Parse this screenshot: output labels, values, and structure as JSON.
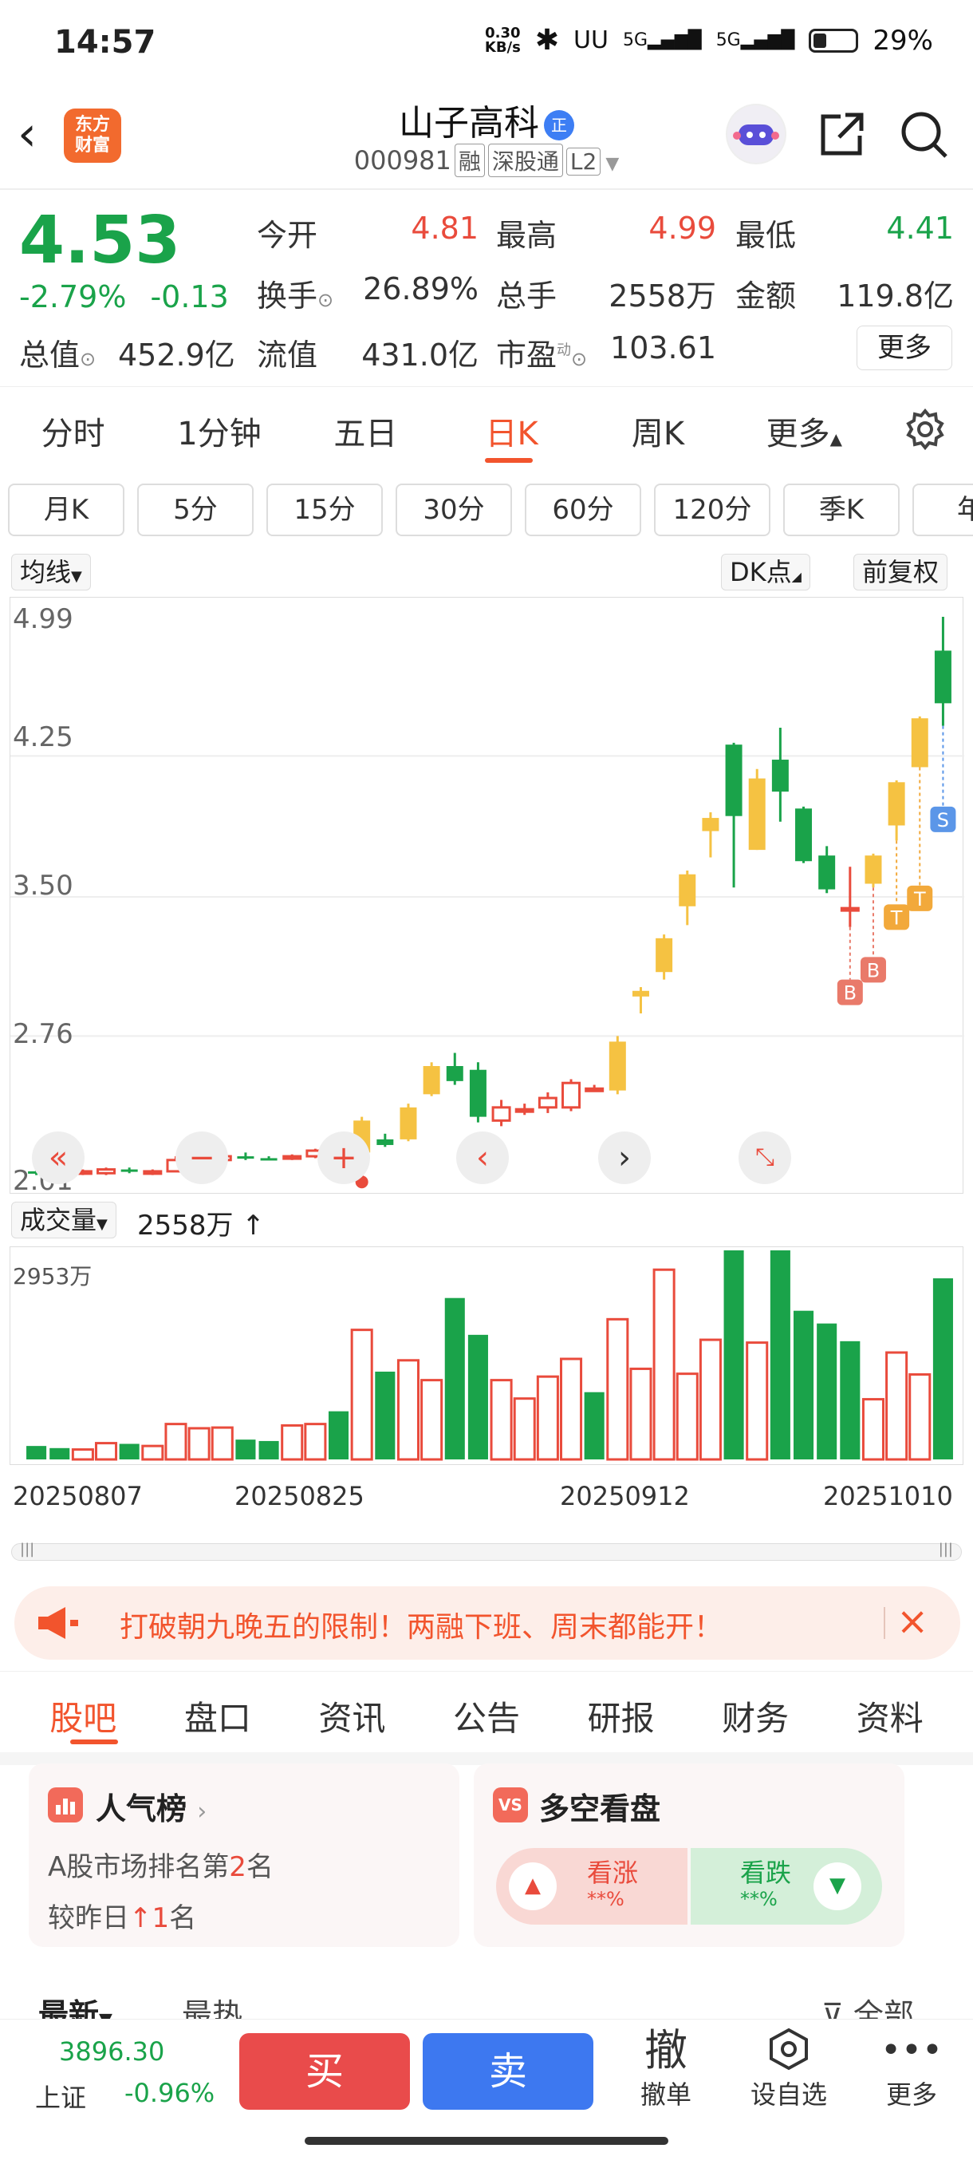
{
  "status_bar": {
    "time": "14:57",
    "speed_top": "0.30",
    "speed_bottom": "KB/s",
    "net1": "5G",
    "net2": "5G",
    "battery": "29%"
  },
  "header": {
    "logo_line1": "东方",
    "logo_line2": "财富",
    "stock_name": "山子高科",
    "badge": "正",
    "code": "000981",
    "tags": [
      "融",
      "深股通",
      "L2"
    ]
  },
  "quote": {
    "price": "4.53",
    "change_pct": "-2.79%",
    "change": "-0.13",
    "open_label": "今开",
    "open": "4.81",
    "high_label": "最高",
    "high": "4.99",
    "low_label": "最低",
    "low": "4.41",
    "turnover_label": "换手",
    "turnover": "26.89%",
    "volume_label": "总手",
    "volume": "2558万",
    "amount_label": "金额",
    "amount": "119.8亿",
    "mktcap_label": "总值",
    "mktcap": "452.9亿",
    "float_label": "流值",
    "float": "431.0亿",
    "pe_label": "市盈",
    "pe_sup": "动",
    "pe": "103.61",
    "more": "更多"
  },
  "chart_tabs": [
    "分时",
    "1分钟",
    "五日",
    "日K",
    "周K",
    "更多"
  ],
  "period_chips": [
    "月K",
    "5分",
    "15分",
    "30分",
    "60分",
    "120分",
    "季K",
    "年"
  ],
  "chart_controls": {
    "ma": "均线",
    "dk": "DK点",
    "adjust": "前复权"
  },
  "y_axis": [
    "4.99",
    "4.25",
    "3.50",
    "2.76",
    "2.01"
  ],
  "volume_header": {
    "label": "成交量",
    "value": "2558万",
    "max": "2953万"
  },
  "date_labels": [
    "20250807",
    "20250825",
    "20250912",
    "20251010"
  ],
  "signal_labels": {
    "buy": "B",
    "sell": "S",
    "t": "T"
  },
  "colors": {
    "up": "#e94b3c",
    "down": "#1aa34a",
    "yellow": "#f5c242",
    "accent": "#f2542d"
  },
  "chart_data": {
    "type": "candlestick",
    "ylim": [
      2.01,
      4.99
    ],
    "candles": [
      {
        "o": 2.04,
        "h": 2.06,
        "l": 2.02,
        "c": 2.03,
        "k": "down"
      },
      {
        "o": 2.03,
        "h": 2.05,
        "l": 2.02,
        "c": 2.04,
        "k": "down"
      },
      {
        "o": 2.03,
        "h": 2.05,
        "l": 2.02,
        "c": 2.04,
        "k": "up"
      },
      {
        "o": 2.03,
        "h": 2.06,
        "l": 2.02,
        "c": 2.05,
        "k": "up"
      },
      {
        "o": 2.05,
        "h": 2.06,
        "l": 2.03,
        "c": 2.04,
        "k": "down"
      },
      {
        "o": 2.03,
        "h": 2.05,
        "l": 2.02,
        "c": 2.04,
        "k": "up"
      },
      {
        "o": 2.04,
        "h": 2.12,
        "l": 2.04,
        "c": 2.1,
        "k": "up"
      },
      {
        "o": 2.09,
        "h": 2.12,
        "l": 2.07,
        "c": 2.1,
        "k": "up"
      },
      {
        "o": 2.1,
        "h": 2.13,
        "l": 2.09,
        "c": 2.12,
        "k": "up"
      },
      {
        "o": 2.12,
        "h": 2.14,
        "l": 2.1,
        "c": 2.11,
        "k": "down"
      },
      {
        "o": 2.11,
        "h": 2.12,
        "l": 2.1,
        "c": 2.11,
        "k": "down"
      },
      {
        "o": 2.11,
        "h": 2.13,
        "l": 2.1,
        "c": 2.12,
        "k": "up"
      },
      {
        "o": 2.12,
        "h": 2.16,
        "l": 2.11,
        "c": 2.15,
        "k": "up"
      },
      {
        "o": 2.14,
        "h": 2.16,
        "l": 2.12,
        "c": 2.13,
        "k": "down"
      },
      {
        "o": 2.14,
        "h": 2.33,
        "l": 2.13,
        "c": 2.31,
        "k": "yellow"
      },
      {
        "o": 2.21,
        "h": 2.24,
        "l": 2.17,
        "c": 2.18,
        "k": "down"
      },
      {
        "o": 2.21,
        "h": 2.4,
        "l": 2.2,
        "c": 2.38,
        "k": "yellow"
      },
      {
        "o": 2.45,
        "h": 2.62,
        "l": 2.44,
        "c": 2.6,
        "k": "yellow"
      },
      {
        "o": 2.6,
        "h": 2.67,
        "l": 2.5,
        "c": 2.52,
        "k": "down"
      },
      {
        "o": 2.58,
        "h": 2.62,
        "l": 2.3,
        "c": 2.33,
        "k": "down"
      },
      {
        "o": 2.31,
        "h": 2.42,
        "l": 2.28,
        "c": 2.38,
        "k": "up"
      },
      {
        "o": 2.37,
        "h": 2.4,
        "l": 2.34,
        "c": 2.37,
        "k": "up"
      },
      {
        "o": 2.38,
        "h": 2.46,
        "l": 2.35,
        "c": 2.43,
        "k": "up"
      },
      {
        "o": 2.38,
        "h": 2.53,
        "l": 2.36,
        "c": 2.51,
        "k": "up"
      },
      {
        "o": 2.48,
        "h": 2.5,
        "l": 2.47,
        "c": 2.48,
        "k": "up"
      },
      {
        "o": 2.47,
        "h": 2.76,
        "l": 2.45,
        "c": 2.73,
        "k": "yellow"
      },
      {
        "o": 2.97,
        "h": 3.02,
        "l": 2.88,
        "c": 3.0,
        "k": "yellow"
      },
      {
        "o": 3.1,
        "h": 3.3,
        "l": 3.06,
        "c": 3.28,
        "k": "yellow"
      },
      {
        "o": 3.45,
        "h": 3.64,
        "l": 3.35,
        "c": 3.62,
        "k": "yellow"
      },
      {
        "o": 3.85,
        "h": 3.95,
        "l": 3.71,
        "c": 3.92,
        "k": "yellow"
      },
      {
        "o": 4.31,
        "h": 4.32,
        "l": 3.55,
        "c": 3.93,
        "k": "down"
      },
      {
        "o": 3.75,
        "h": 4.18,
        "l": 3.75,
        "c": 4.13,
        "k": "yellow"
      },
      {
        "o": 4.23,
        "h": 4.4,
        "l": 3.9,
        "c": 4.06,
        "k": "down"
      },
      {
        "o": 3.97,
        "h": 3.98,
        "l": 3.68,
        "c": 3.69,
        "k": "down"
      },
      {
        "o": 3.72,
        "h": 3.77,
        "l": 3.52,
        "c": 3.54,
        "k": "down"
      },
      {
        "o": 3.43,
        "h": 3.66,
        "l": 3.34,
        "c": 3.44,
        "k": "up"
      },
      {
        "o": 3.57,
        "h": 3.73,
        "l": 3.55,
        "c": 3.72,
        "k": "yellow"
      },
      {
        "o": 3.88,
        "h": 4.12,
        "l": 3.8,
        "c": 4.11,
        "k": "yellow"
      },
      {
        "o": 4.19,
        "h": 4.46,
        "l": 4.19,
        "c": 4.45,
        "k": "yellow"
      },
      {
        "o": 4.81,
        "h": 4.99,
        "l": 4.41,
        "c": 4.53,
        "k": "down"
      }
    ],
    "volume": [
      {
        "v": 190,
        "k": "down"
      },
      {
        "v": 160,
        "k": "down"
      },
      {
        "v": 140,
        "k": "up"
      },
      {
        "v": 230,
        "k": "up"
      },
      {
        "v": 220,
        "k": "down"
      },
      {
        "v": 190,
        "k": "up"
      },
      {
        "v": 500,
        "k": "up"
      },
      {
        "v": 440,
        "k": "up"
      },
      {
        "v": 450,
        "k": "up"
      },
      {
        "v": 280,
        "k": "down"
      },
      {
        "v": 260,
        "k": "down"
      },
      {
        "v": 480,
        "k": "up"
      },
      {
        "v": 500,
        "k": "up"
      },
      {
        "v": 680,
        "k": "down"
      },
      {
        "v": 1830,
        "k": "up"
      },
      {
        "v": 1240,
        "k": "down"
      },
      {
        "v": 1400,
        "k": "up"
      },
      {
        "v": 1120,
        "k": "up"
      },
      {
        "v": 2280,
        "k": "down"
      },
      {
        "v": 1760,
        "k": "down"
      },
      {
        "v": 1120,
        "k": "up"
      },
      {
        "v": 860,
        "k": "up"
      },
      {
        "v": 1170,
        "k": "up"
      },
      {
        "v": 1420,
        "k": "up"
      },
      {
        "v": 950,
        "k": "down"
      },
      {
        "v": 1980,
        "k": "up"
      },
      {
        "v": 1280,
        "k": "up"
      },
      {
        "v": 2680,
        "k": "up"
      },
      {
        "v": 1210,
        "k": "up"
      },
      {
        "v": 1690,
        "k": "up"
      },
      {
        "v": 2953,
        "k": "down"
      },
      {
        "v": 1650,
        "k": "up"
      },
      {
        "v": 2953,
        "k": "down"
      },
      {
        "v": 2100,
        "k": "down"
      },
      {
        "v": 1920,
        "k": "down"
      },
      {
        "v": 1670,
        "k": "down"
      },
      {
        "v": 850,
        "k": "up"
      },
      {
        "v": 1510,
        "k": "up"
      },
      {
        "v": 1200,
        "k": "up"
      },
      {
        "v": 2558,
        "k": "down"
      }
    ]
  },
  "scroll": {
    "left": "|||",
    "right": "|||"
  },
  "banner": {
    "text": "打破朝九晚五的限制！两融下班、周末都能开！"
  },
  "bottom_tabs": [
    "股吧",
    "盘口",
    "资讯",
    "公告",
    "研报",
    "财务",
    "资料"
  ],
  "popularity": {
    "title": "人气榜",
    "line1_pre": "A股市场排名第",
    "rank": "2",
    "line1_post": "名",
    "line2_pre": "较昨日",
    "change": "1",
    "line2_post": "名"
  },
  "sentiment": {
    "title": "多空看盘",
    "bull": "看涨",
    "bull_pct": "**%",
    "bear": "看跌",
    "bear_pct": "**%"
  },
  "feed_tabs": {
    "latest": "最新",
    "hot": "最热",
    "all": "全部"
  },
  "bottom_bar": {
    "index_value": "3896.30",
    "index_name": "上证",
    "index_change": "-0.96%",
    "buy": "买",
    "sell": "卖",
    "cancel_icon": "撤",
    "cancel": "撤单",
    "watch": "设自选",
    "more": "更多"
  }
}
